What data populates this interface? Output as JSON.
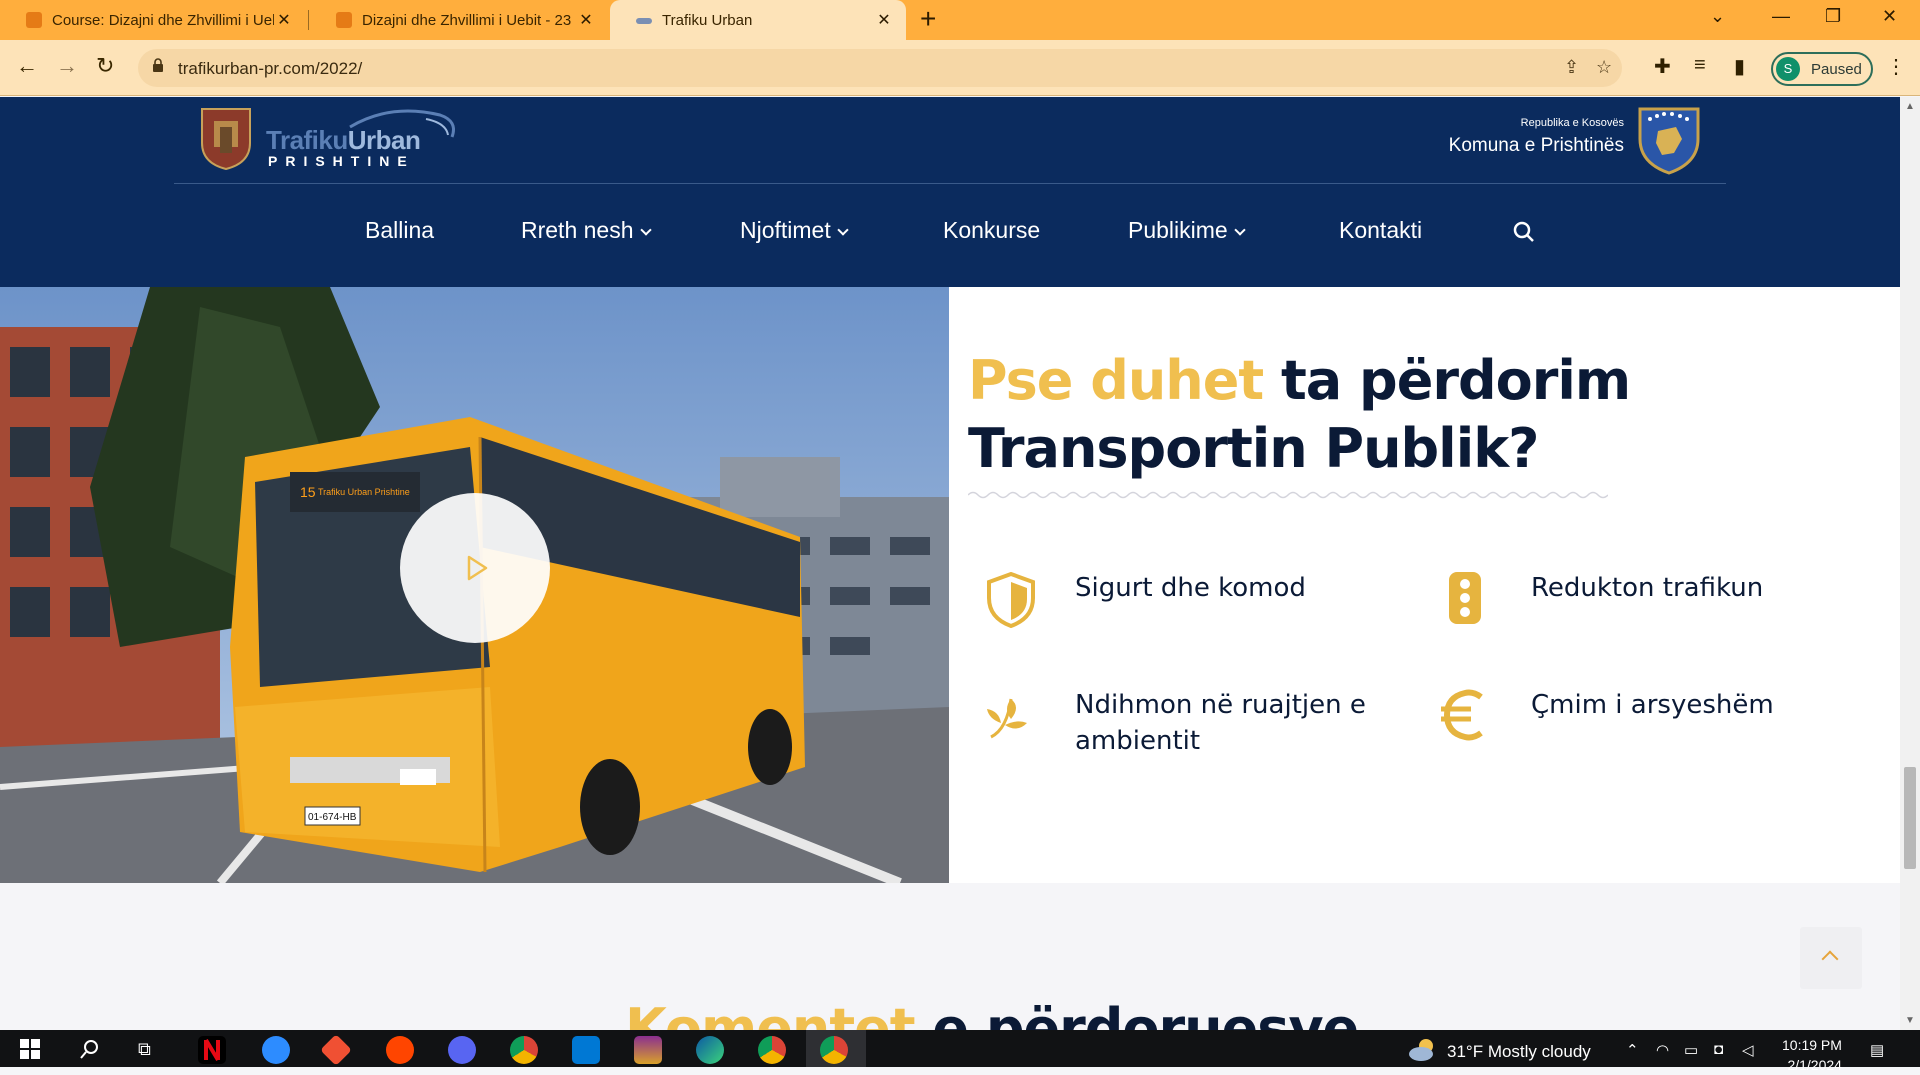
{
  "browser": {
    "tabs": [
      {
        "title": "Course: Dizajni dhe Zhvillimi i Uebit",
        "active": false
      },
      {
        "title": "Dizajni dhe Zhvillimi i Uebit - 23",
        "active": false
      },
      {
        "title": "Trafiku Urban",
        "active": true
      }
    ],
    "url": "trafikurban-pr.com/2022/",
    "profile_initial": "S",
    "profile_status": "Paused"
  },
  "site": {
    "logo_word1": "Trafiku",
    "logo_word2": "Urban",
    "logo_sub": "PRISHTINE",
    "gov_small": "Republika e Kosovës",
    "gov_big": "Komuna e Prishtinës",
    "menu": [
      {
        "label": "Ballina",
        "dropdown": false
      },
      {
        "label": "Rreth nesh",
        "dropdown": true
      },
      {
        "label": "Njoftimet",
        "dropdown": true
      },
      {
        "label": "Konkurse",
        "dropdown": false
      },
      {
        "label": "Publikime",
        "dropdown": true
      },
      {
        "label": "Kontakti",
        "dropdown": false
      }
    ],
    "hero": {
      "title_accent": "Pse duhet",
      "title_rest": "ta përdorim",
      "title_line2": "Transportin Publik?",
      "bus_route": "15",
      "bus_sign": "Trafiku Urban Prishtine",
      "bus_plate": "01-674-HB",
      "features": [
        {
          "label": "Sigurt dhe komod",
          "icon": "shield-icon"
        },
        {
          "label": "Redukton trafikun",
          "icon": "traffic-light-icon"
        },
        {
          "label": "Ndihmon në ruajtjen e ambientit",
          "icon": "leaf-icon"
        },
        {
          "label": "Çmim i arsyeshëm",
          "icon": "euro-icon"
        }
      ]
    },
    "comments_accent": "Komentet",
    "comments_rest": "e përdoruesve"
  },
  "taskbar": {
    "weather": "31°F  Mostly cloudy",
    "time": "10:19 PM",
    "date": "2/1/2024"
  },
  "colors": {
    "header": "#0b2b5e",
    "accent": "#f0bf4f",
    "chrome": "#ffae3d"
  }
}
